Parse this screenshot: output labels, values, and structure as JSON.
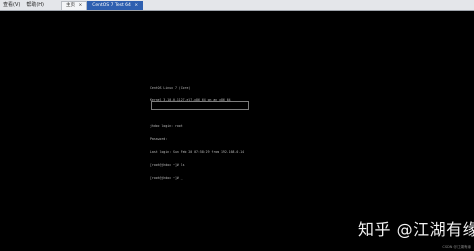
{
  "menu": {
    "view_label": "查看(V)",
    "help_label": "帮助(H)"
  },
  "tabs": [
    {
      "label": "主页"
    },
    {
      "label": "CentOS 7 Test 64",
      "active": true
    }
  ],
  "terminal": {
    "lines": [
      "CentOS Linux 7 (Core)",
      "Kernel 3.10.0-1127.el7.x86_64 on an x86_64",
      "",
      "jhdoc login: root",
      "Password:",
      "Last login: Sun Feb 20 07:58:29 from 192.168.0.14",
      "[root@jhdoc ~]# ls",
      "[root@jhdoc ~]# _"
    ]
  },
  "watermark": "知乎 @江湖有缘",
  "credit": "CSDN @江湖有缘"
}
